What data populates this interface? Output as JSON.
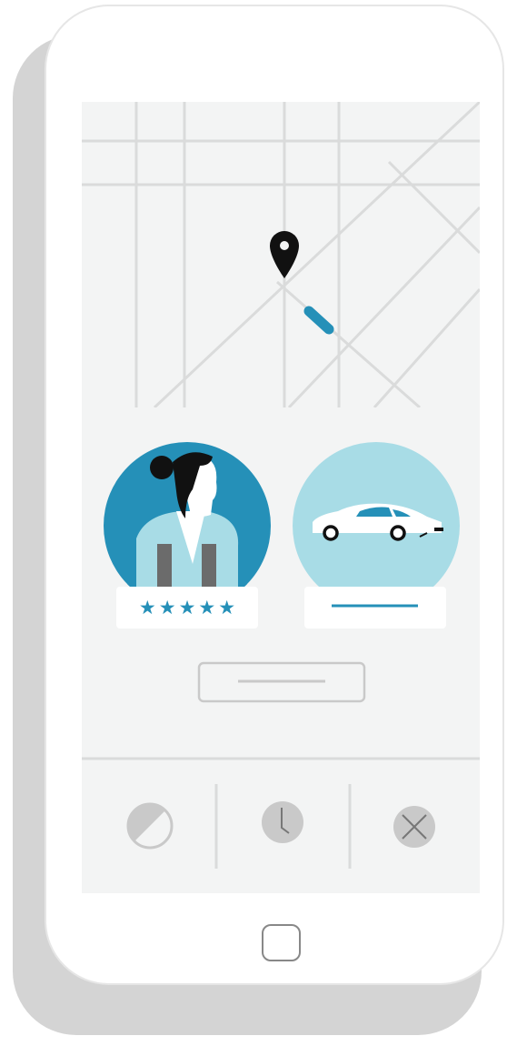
{
  "colors": {
    "shadow": "#d4d4d4",
    "phone_body": "#ffffff",
    "phone_outline": "#e6e6e6",
    "screen_bg": "#f3f4f4",
    "map_lines": "#dadbdb",
    "accent_dark": "#2590b8",
    "accent_light": "#a8dce6",
    "pin": "#111111",
    "card_bg": "#ffffff",
    "icon_grey": "#c9c9c9",
    "icon_stroke": "#777777"
  },
  "rating": {
    "stars": 5,
    "max": 5,
    "glyph": "★"
  },
  "icons": {
    "pin": "location-pin-icon",
    "car_marker": "car-marker-icon",
    "driver": "driver-avatar-icon",
    "vehicle": "vehicle-photo-icon",
    "action_1": "half-circle-icon",
    "action_2": "clock-icon",
    "action_3": "cancel-icon",
    "home": "home-button-icon"
  }
}
